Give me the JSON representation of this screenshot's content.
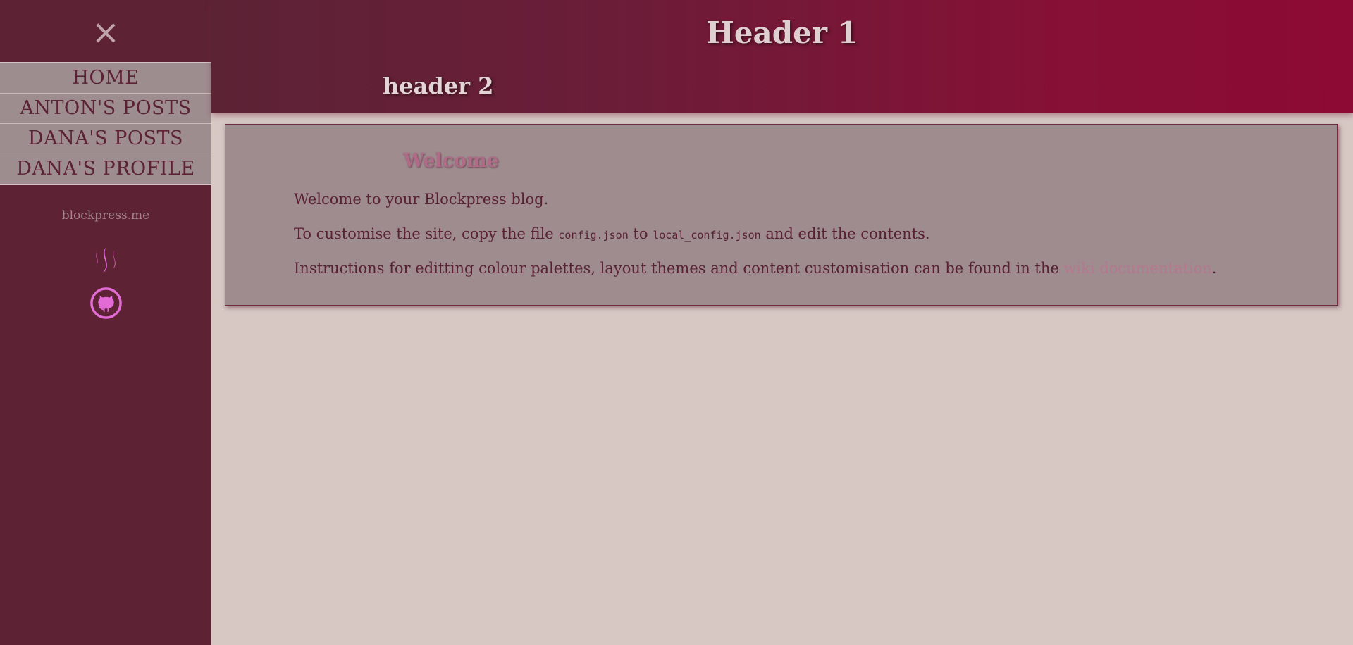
{
  "sidebar": {
    "close_icon": "×",
    "nav_items": [
      {
        "label": "HOME"
      },
      {
        "label": "ANTON'S POSTS"
      },
      {
        "label": "DANA'S POSTS"
      },
      {
        "label": "DANA'S PROFILE"
      }
    ],
    "site_link": "blockpress.me",
    "social_icons": [
      "steem-icon",
      "github-icon"
    ]
  },
  "header": {
    "title": "Header 1",
    "subtitle": "header 2"
  },
  "card": {
    "heading": "Welcome",
    "p1": "Welcome to your Blockpress blog.",
    "p2": {
      "before": "To customise the site, copy the file ",
      "code1": "config.json",
      "middle": " to ",
      "code2": "local_config.json",
      "after": " and edit the contents."
    },
    "p3": {
      "before": "Instructions for editting colour palettes, layout themes and content customisation can be found in the ",
      "link": "wiki documentation",
      "after": "."
    }
  },
  "colors": {
    "sidebar_bg": "#5d2234",
    "nav_bg": "#9e8d8f",
    "header_gradient_start": "#5c2335",
    "header_gradient_end": "#8c0a33",
    "page_bg": "#d7c8c4",
    "card_bg": "#9e8c8e",
    "icon_accent": "#e36bd6",
    "link": "#b47891"
  }
}
